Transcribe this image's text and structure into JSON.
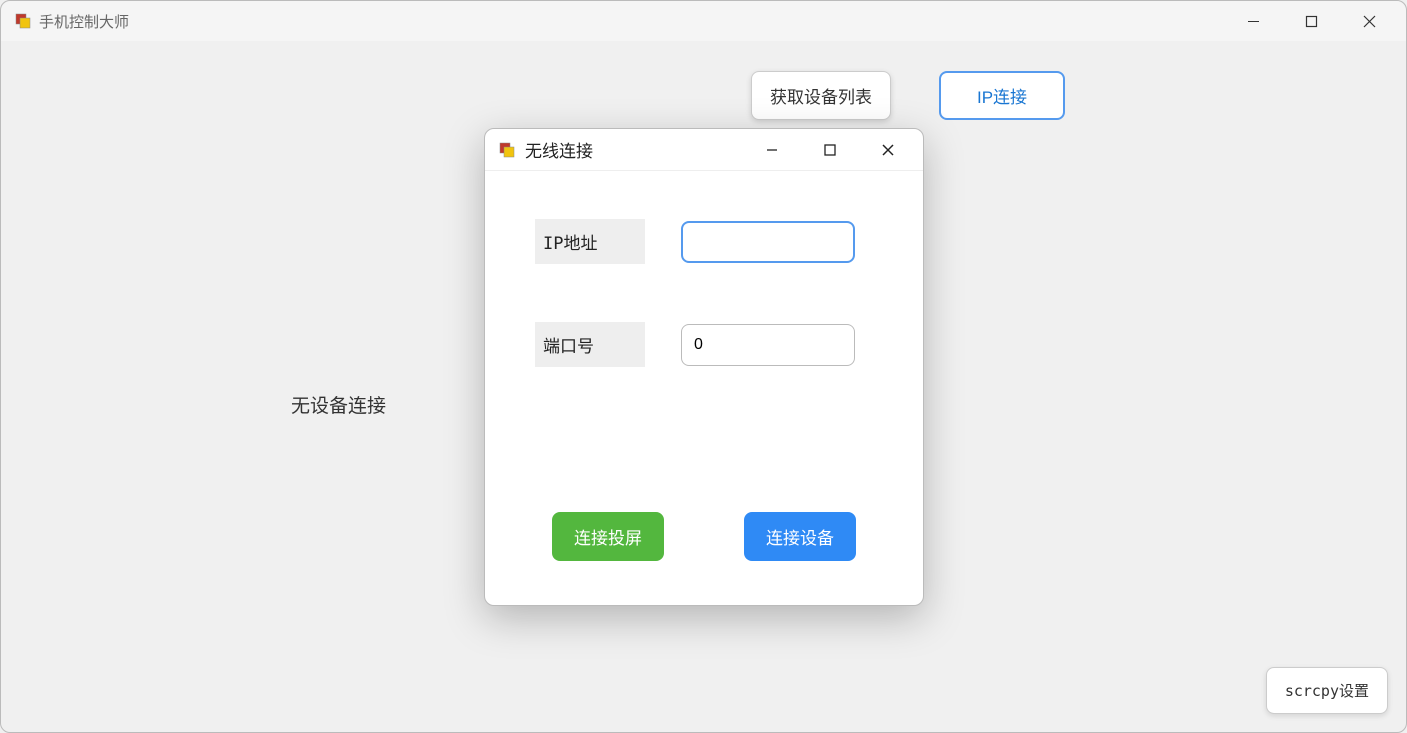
{
  "mainWindow": {
    "title": "手机控制大师",
    "noDeviceText": "无设备连接",
    "buttons": {
      "getDeviceList": "获取设备列表",
      "ipConnect": "IP连接",
      "scrcpySettings": "scrcpy设置"
    }
  },
  "dialog": {
    "title": "无线连接",
    "fields": {
      "ipAddress": {
        "label": "IP地址",
        "value": ""
      },
      "port": {
        "label": "端口号",
        "value": "0"
      }
    },
    "buttons": {
      "connectScreen": "连接投屏",
      "connectDevice": "连接设备"
    }
  }
}
